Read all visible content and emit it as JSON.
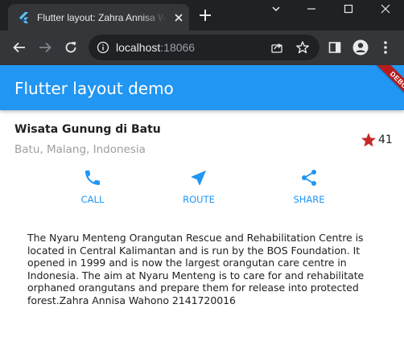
{
  "browser": {
    "tab_title": "Flutter layout: Zahra Annisa Wahono",
    "url_host": "localhost",
    "url_port": ":18066"
  },
  "app": {
    "title": "Flutter layout demo",
    "debug_banner": "DEBUG",
    "place_name": "Wisata Gunung di Batu",
    "place_location": "Batu, Malang, Indonesia",
    "rating": "41",
    "buttons": [
      {
        "label": "CALL",
        "icon": "phone-icon"
      },
      {
        "label": "ROUTE",
        "icon": "near-me-icon"
      },
      {
        "label": "SHARE",
        "icon": "share-icon"
      }
    ],
    "description": "The Nyaru Menteng Orangutan Rescue and Rehabilitation Centre is located in Central Kalimantan and is run by the BOS Foundation. It opened in 1999 and is now the largest orangutan care centre in Indonesia. The aim at Nyaru Menteng is to care for and rehabilitate orphaned orangutans and prepare them for release into protected forest.Zahra Annisa Wahono 2141720016"
  },
  "colors": {
    "appbar": "#2196f3",
    "accent": "#2196f3",
    "star": "#c62828",
    "ribbon": "#b71c1c"
  }
}
